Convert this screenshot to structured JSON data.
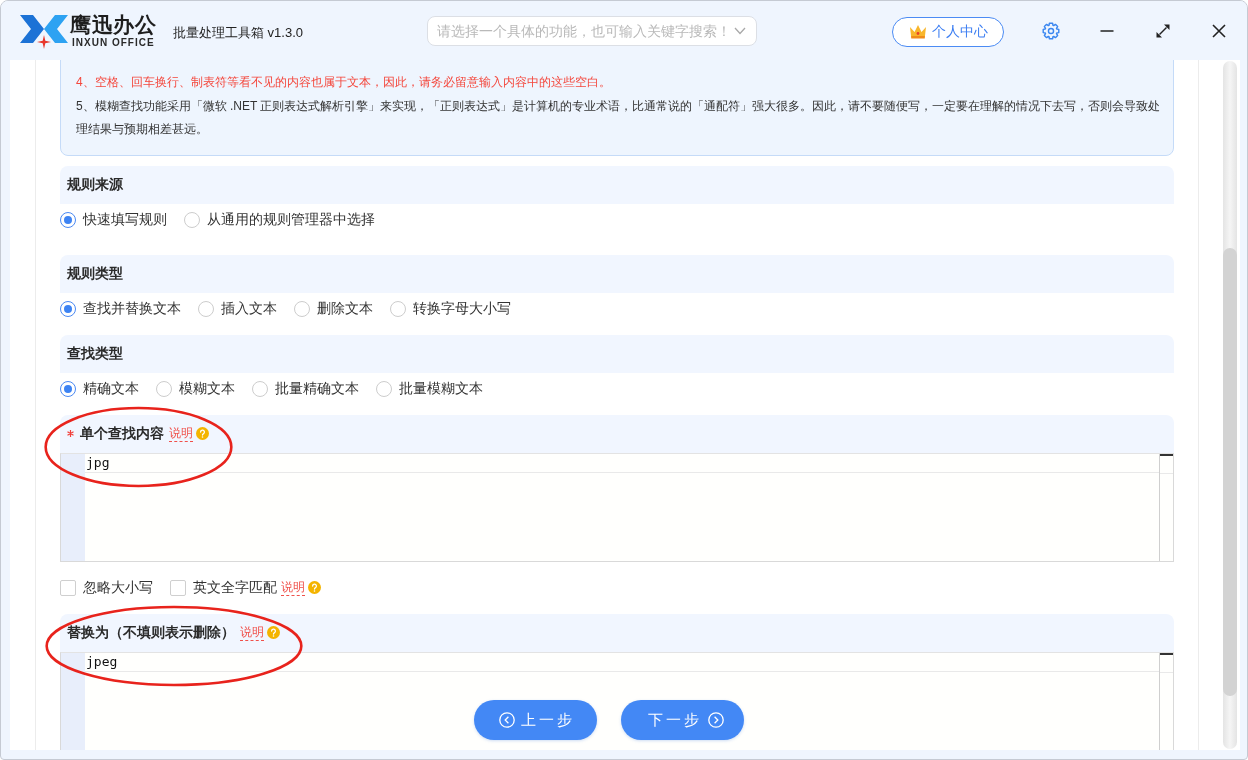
{
  "titlebar": {
    "brand": "鹰迅办公",
    "brand_subtitle": "INXUN OFFICE",
    "app_title": "批量处理工具箱 v1.3.0",
    "search": {
      "placeholder": "请选择一个具体的功能，也可输入关键字搜索！"
    },
    "account_button": "个人中心"
  },
  "notes": [
    {
      "kind": "warning",
      "text": "4、空格、回车换行、制表符等看不见的内容也属于文本，因此，请务必留意输入内容中的这些空白。"
    },
    {
      "kind": "plain",
      "text": "5、模糊查找功能采用「微软 .NET 正则表达式解析引擎」来实现，「正则表达式」是计算机的专业术语，比通常说的「通配符」强大很多。因此，请不要随便写，一定要在理解的情况下去写，否则会导致处理结果与预期相差甚远。"
    }
  ],
  "sections": [
    {
      "kind": "radio",
      "title": "规则来源",
      "options": [
        {
          "label": "快速填写规则",
          "selected": true
        },
        {
          "label": "从通用的规则管理器中选择",
          "selected": false
        }
      ]
    },
    {
      "kind": "radio",
      "title": "规则类型",
      "options": [
        {
          "label": "查找并替换文本",
          "selected": true
        },
        {
          "label": "插入文本",
          "selected": false
        },
        {
          "label": "删除文本",
          "selected": false
        },
        {
          "label": "转换字母大小写",
          "selected": false
        }
      ]
    },
    {
      "kind": "radio",
      "title": "查找类型",
      "options": [
        {
          "label": "精确文本",
          "selected": true
        },
        {
          "label": "模糊文本",
          "selected": false
        },
        {
          "label": "批量精确文本",
          "selected": false
        },
        {
          "label": "批量模糊文本",
          "selected": false
        }
      ]
    },
    {
      "kind": "editor",
      "title": "单个查找内容",
      "required": true,
      "help": "说明",
      "circled": true,
      "value": "jpg",
      "checkboxes": [
        {
          "label": "忽略大小写",
          "checked": false
        },
        {
          "label": "英文全字匹配",
          "checked": false,
          "help": "说明"
        }
      ]
    },
    {
      "kind": "editor",
      "title": "替换为（不填则表示删除）",
      "required": false,
      "help": "说明",
      "circled": true,
      "value": "jpeg"
    }
  ],
  "nav": {
    "back": "上一步",
    "next": "下一步"
  }
}
